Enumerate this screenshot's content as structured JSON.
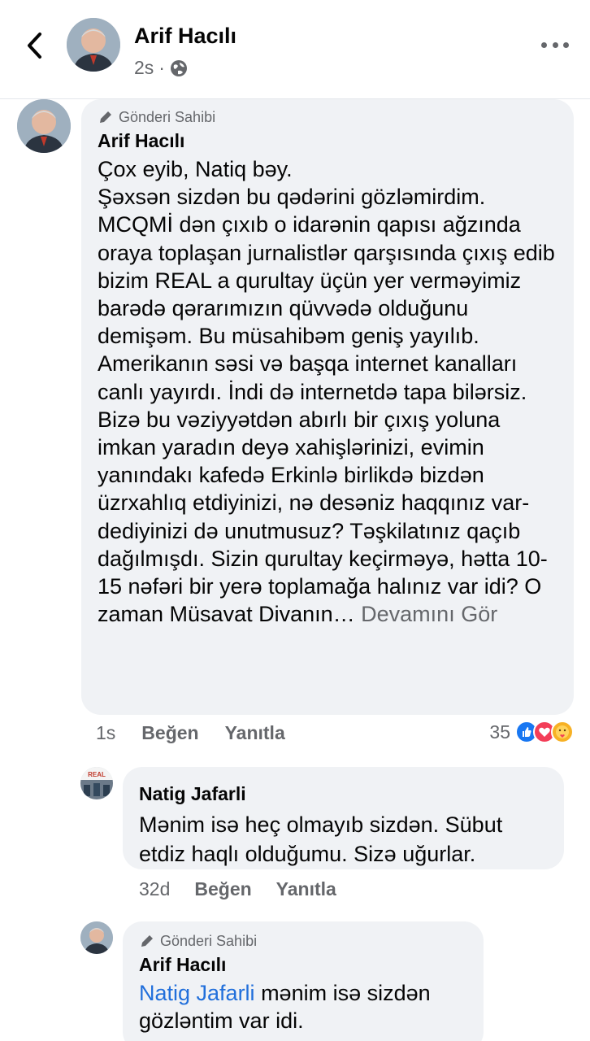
{
  "header": {
    "title": "Arif Hacılı",
    "time": "2s",
    "privacy_icon": "globe-icon",
    "back_icon": "chevron-left-icon",
    "more_icon": "more-dots-icon"
  },
  "comments": [
    {
      "badge": "Gönderi Sahibi",
      "author": "Arif Hacılı",
      "text": "Çox eyib, Natiq bəy.\nŞəxsən sizdən bu qədərini gözləmirdim. MCQMİ dən çıxıb o idarənin qapısı ağzında oraya toplaşan jurnalistlər qarşısında çıxış edib bizim REAL a qurultay üçün yer verməyimiz barədə qərarımızın  qüvvədə olduğunu demişəm. Bu müsahibəm geniş yayılıb. Amerikanın səsi və başqa internet kanalları  canlı yayırdı. İndi də internetdə tapa bilərsiz. Bizə bu vəziyyətdən abırlı bir çıxış yoluna imkan yaradın deyə xahişlərinizi, evimin yanındakı kafedə Erkinlə birlikdə bizdən üzrxahlıq etdiyinizi, nə desəniz haqqınız var- dediyinizi də unutmusuz? Təşkilatınız qaçıb dağılmışdı. Sizin qurultay keçirməyə, hətta 10-15 nəfəri bir yerə toplamağa  halınız var idi? O zaman Müsavat Divanın…",
      "see_more": "Devamını Gör",
      "time": "1s",
      "like_label": "Beğen",
      "reply_label": "Yanıtla",
      "reaction_count": "35",
      "reactions": [
        "like-icon",
        "love-icon",
        "care-icon"
      ]
    },
    {
      "author": "Natig Jafarli",
      "avatar_text": "REAL",
      "text": "Mənim isə heç olmayıb sizdən. Sübut etdiz haqlı olduğumu. Sizə uğurlar.",
      "time": "32d",
      "like_label": "Beğen",
      "reply_label": "Yanıtla"
    },
    {
      "badge": "Gönderi Sahibi",
      "author": "Arif Hacılı",
      "mention": "Natig Jafarli",
      "text": " mənim isə sizdən gözləntim var idi."
    }
  ],
  "colors": {
    "bubble": "#f0f2f5",
    "secondary_text": "#65676b",
    "mention": "#216fdb",
    "like": "#1877f2",
    "love": "#f33e58"
  }
}
